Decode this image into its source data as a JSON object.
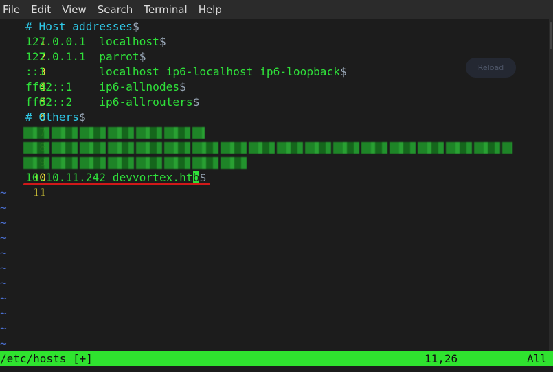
{
  "menu": {
    "items": [
      "File",
      "Edit",
      "View",
      "Search",
      "Terminal",
      "Help"
    ]
  },
  "editor": {
    "lines": [
      {
        "n": "1",
        "text": "# Host addresses",
        "type": "comment"
      },
      {
        "n": "2",
        "text": "127.0.0.1  localhost",
        "type": "text"
      },
      {
        "n": "3",
        "text": "127.0.1.1  parrot",
        "type": "text"
      },
      {
        "n": "4",
        "text": "::1        localhost ip6-localhost ip6-loopback",
        "type": "text"
      },
      {
        "n": "5",
        "text": "ff02::1    ip6-allnodes",
        "type": "text"
      },
      {
        "n": "6",
        "text": "ff02::2    ip6-allrouters",
        "type": "text"
      },
      {
        "n": "7",
        "text": "# Others",
        "type": "comment"
      },
      {
        "n": "8",
        "text": "",
        "type": "redacted"
      },
      {
        "n": "9",
        "text": "",
        "type": "redacted"
      },
      {
        "n": "10",
        "text": "",
        "type": "redacted"
      },
      {
        "n": "11",
        "text": "10.10.11.242 devvortex.ht",
        "cursor_char": "b",
        "type": "text"
      }
    ],
    "eol_marker": "$",
    "tilde": "~"
  },
  "overlay": {
    "reload_label": "Reload"
  },
  "status": {
    "file": "/etc/hosts [+]",
    "position": "11,26",
    "scroll": "All"
  },
  "colors": {
    "line_number": "#f0e23c",
    "comment": "#2fc8e6",
    "text": "#2fe03a",
    "status_bg": "#2fe32f",
    "underline": "#d11919"
  }
}
